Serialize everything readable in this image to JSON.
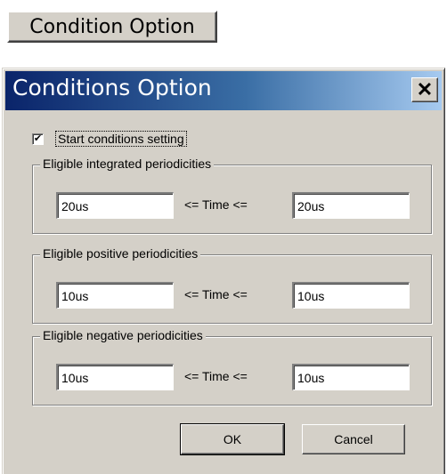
{
  "launcher": {
    "label": "Condition Option"
  },
  "dialog": {
    "title": "Conditions Option",
    "close_symbol": "✕",
    "start_conditions": {
      "label": "Start conditions setting",
      "checked": true,
      "check_glyph": "✔"
    },
    "groups": [
      {
        "legend": "Eligible integrated periodicities",
        "min_value": "20us",
        "operator": "<= Time <=",
        "max_value": "20us"
      },
      {
        "legend": "Eligible positive periodicities",
        "min_value": "10us",
        "operator": "<= Time <=",
        "max_value": "10us"
      },
      {
        "legend": "Eligible negative periodicities",
        "min_value": "10us",
        "operator": "<= Time <=",
        "max_value": "10us"
      }
    ],
    "ok_label": "OK",
    "cancel_label": "Cancel"
  },
  "colors": {
    "face": "#d4d0c8",
    "title_gradient_start": "#0a246a",
    "title_gradient_end": "#a6caf0",
    "title_text": "#ffffff"
  }
}
